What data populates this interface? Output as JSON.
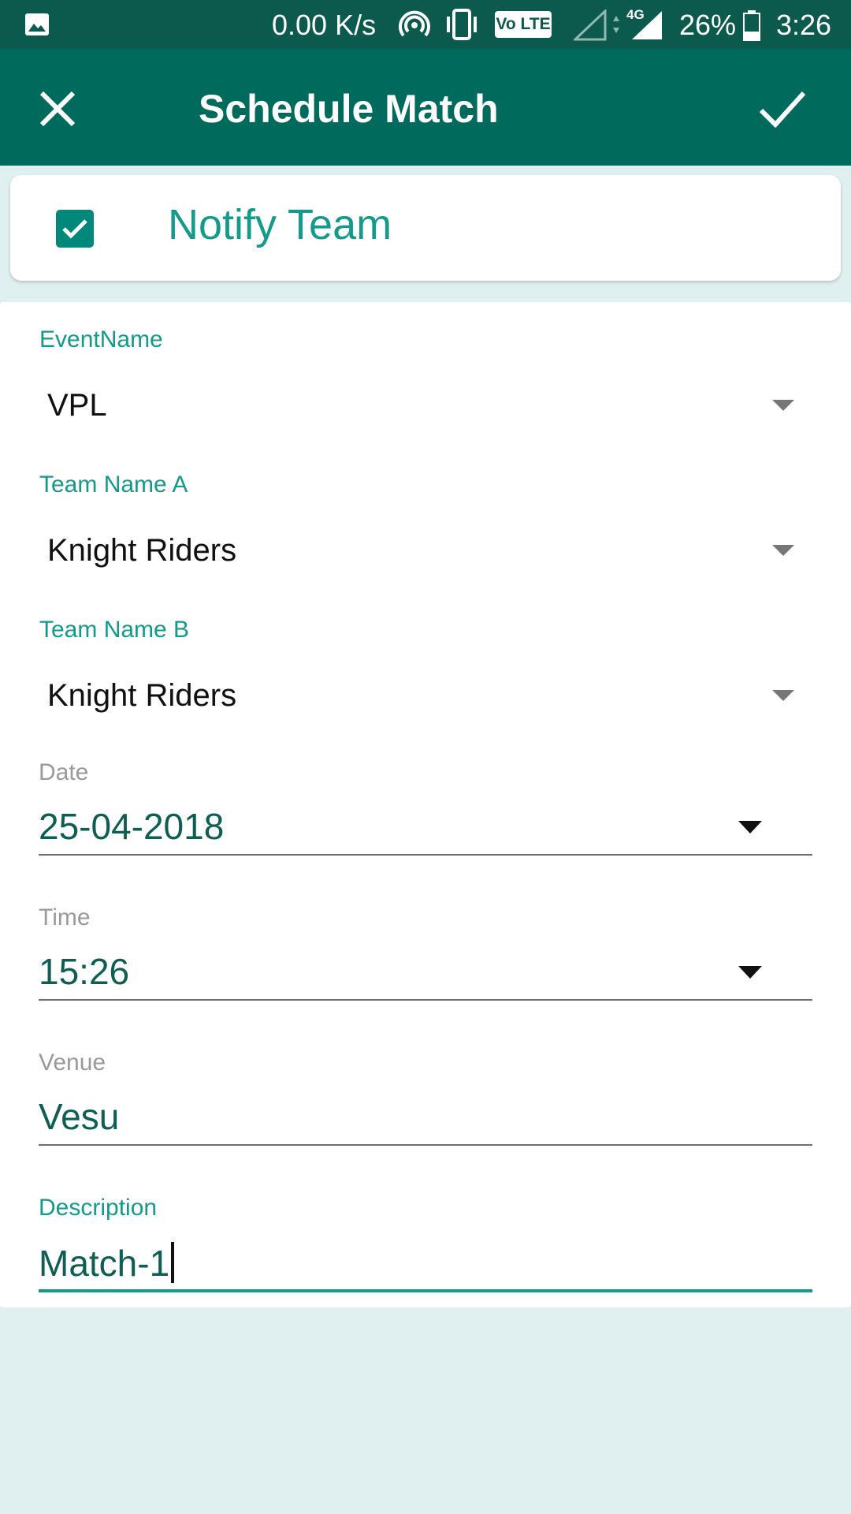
{
  "status_bar": {
    "net_speed": "0.00 K/s",
    "volte": "Vo LTE",
    "network_type": "4G",
    "battery_percent": "26%",
    "clock": "3:26",
    "icons": [
      "gallery-icon",
      "hotspot-icon",
      "vibrate-icon",
      "volte-badge",
      "signal-icon",
      "data-arrows-icon",
      "signal-4g-icon",
      "battery-icon"
    ]
  },
  "app_bar": {
    "title": "Schedule Match",
    "close_icon": "close-icon",
    "confirm_icon": "check-icon"
  },
  "notify": {
    "label": "Notify Team",
    "checked": true
  },
  "form": {
    "event_name": {
      "label": "EventName",
      "value": "VPL"
    },
    "team_a": {
      "label": "Team Name A",
      "value": "Knight Riders"
    },
    "team_b": {
      "label": "Team Name B",
      "value": "Knight Riders"
    },
    "date": {
      "label": "Date",
      "value": "25-04-2018"
    },
    "time": {
      "label": "Time",
      "value": "15:26"
    },
    "venue": {
      "label": "Venue",
      "value": "Vesu"
    },
    "description": {
      "label": "Description",
      "value": "Match-1"
    }
  },
  "colors": {
    "status_bar": "#0b5a4d",
    "app_bar": "#006b5d",
    "accent": "#139a8a",
    "field_text": "#0f5e54",
    "background": "#e0f0f0"
  }
}
